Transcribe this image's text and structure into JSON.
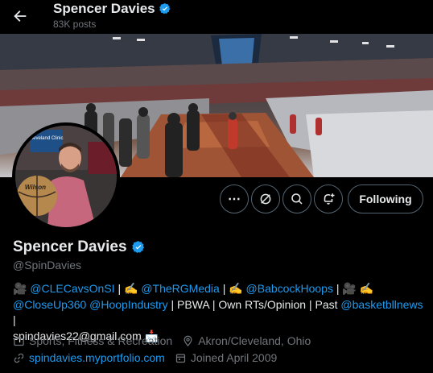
{
  "header": {
    "name": "Spencer Davies",
    "posts": "83K posts"
  },
  "profile": {
    "name": "Spencer Davies",
    "handle": "@SpinDavies",
    "avatar_sign_text": "Cleveland Clinic",
    "avatar_ball_text": "Wilson"
  },
  "actions": {
    "more_label": "⋯",
    "following_label": "Following"
  },
  "bio": {
    "emoji_camera": "🎥",
    "emoji_pen": "✍️",
    "mention1": "@CLECavsOnSI",
    "sep1": " | ",
    "mention2": "@TheRGMedia",
    "sep2": " | ",
    "mention3": "@BabcockHoops",
    "sep3": " | ",
    "mention4": "@CloseUp360",
    "mention5": "@HoopIndustry",
    "text1": " | PBWA | Own RTs/Opinion | Past ",
    "mention6": "@basketbllnews",
    "sep4": " |",
    "email": "spindavies22@gmail.com",
    "emoji_mail": "📩"
  },
  "meta": {
    "category": "Sports, Fitness & Recreation",
    "location": "Akron/Cleveland, Ohio",
    "website": "spindavies.myportfolio.com",
    "joined": "Joined April 2009"
  },
  "colors": {
    "accent": "#1d9bf0",
    "muted": "#71767b",
    "text": "#e7e9ea"
  }
}
